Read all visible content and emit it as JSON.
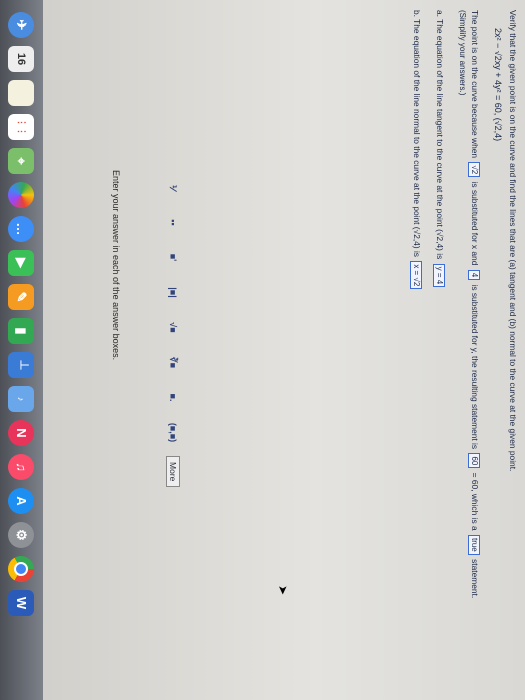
{
  "question": {
    "prompt": "Verify that the given point is on the curve and find the lines that are (a) tangent and (b) normal to the curve at the given point.",
    "equation": "2x² − √2xy + 4y² = 60, (√2,4)",
    "point_check": {
      "pre": "The point is on the curve because when",
      "box1": "√2",
      "mid1": "is substituted for x and",
      "box2": "4",
      "mid2": "is substituted for y, the resulting statement is",
      "box3": "60",
      "mid3": "= 60, which is a",
      "box4": "true",
      "post": "statement."
    },
    "simplify_note": "(Simplify your answers.)",
    "part_a": {
      "text": "a. The equation of the line tangent to the curve at the point (√2,4) is",
      "answer": "y = 4"
    },
    "part_b": {
      "text": "b. The equation of the line normal to the curve at the point (√2,4) is",
      "answer": "x = √2"
    }
  },
  "toolbar": {
    "tools": [
      "⅟",
      "▪▪",
      "■'",
      "|■|",
      "√■",
      "∛■",
      "■.",
      "(■,■)"
    ],
    "more_label": "More"
  },
  "footer": {
    "text": "Enter your answer in each of the answer boxes."
  },
  "dock": {
    "calendar_day": "16",
    "icons": [
      "launchpad-icon",
      "safari-icon",
      "calendar-icon",
      "notes-icon",
      "reminders-icon",
      "maps-icon",
      "photos-icon",
      "messages-icon",
      "facetime-icon",
      "pages-icon",
      "numbers-icon",
      "keynote-icon",
      "itunes-icon",
      "news-icon",
      "music-icon",
      "appstore-icon",
      "settings-icon",
      "chrome-icon",
      "word-icon"
    ],
    "colors": {
      "accent": "#3c6dd6"
    }
  }
}
